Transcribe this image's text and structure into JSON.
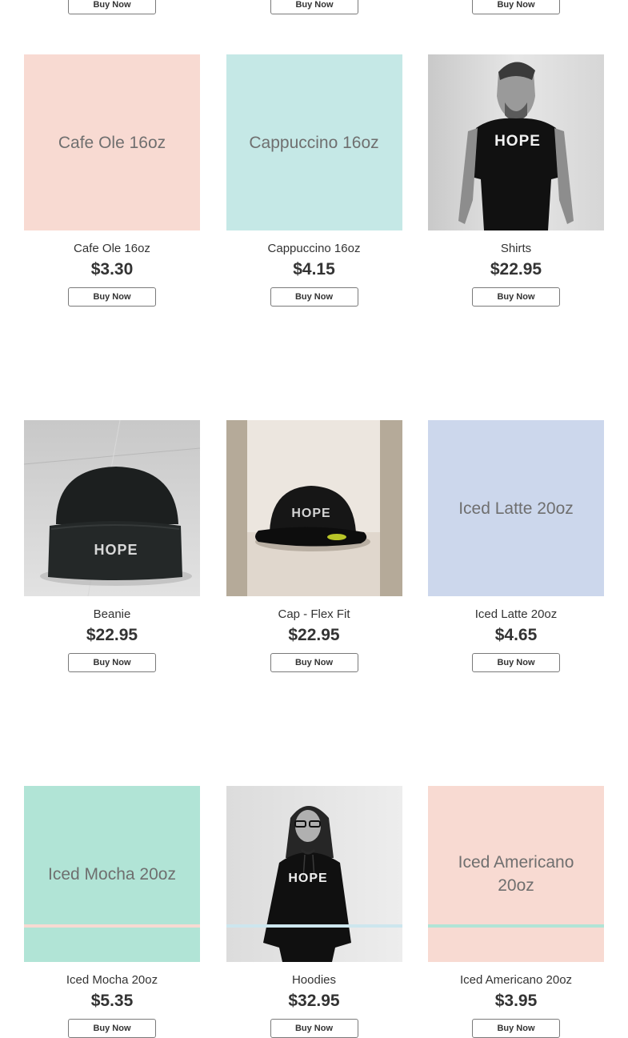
{
  "colors": {
    "pink": "#f8dad2",
    "teal": "#c5e8e6",
    "lavender": "#ccd7ec",
    "mint": "#b1e4d6",
    "peek_blue": "#cde6ee"
  },
  "top_row": {
    "buttons": [
      "Buy Now",
      "Buy Now",
      "Buy Now"
    ]
  },
  "products": [
    {
      "name": "Cafe Ole 16oz",
      "price": "$3.30",
      "tile_text": "Cafe Ole 16oz",
      "tile": "pink",
      "button": "Buy Now"
    },
    {
      "name": "Cappuccino 16oz",
      "price": "$4.15",
      "tile_text": "Cappuccino 16oz",
      "tile": "teal",
      "button": "Buy Now"
    },
    {
      "name": "Shirts",
      "price": "$22.95",
      "photo": "man-in-black-hope-tshirt",
      "photo_text": "HOPE",
      "button": "Buy Now"
    },
    {
      "name": "Beanie",
      "price": "$22.95",
      "photo": "black-hope-beanie",
      "photo_text": "HOPE",
      "button": "Buy Now"
    },
    {
      "name": "Cap - Flex Fit",
      "price": "$22.95",
      "photo": "black-hope-flexfit-cap",
      "photo_text": "HOPE",
      "button": "Buy Now"
    },
    {
      "name": "Iced Latte 20oz",
      "price": "$4.65",
      "tile_text": "Iced Latte 20oz",
      "tile": "lavender",
      "button": "Buy Now"
    },
    {
      "name": "Iced Mocha 20oz",
      "price": "$5.35",
      "tile_text": "Iced Mocha 20oz",
      "tile": "mint",
      "button": "Buy Now"
    },
    {
      "name": "Hoodies",
      "price": "$32.95",
      "photo": "woman-in-black-hope-hoodie",
      "photo_text": "HOPE",
      "button": "Buy Now"
    },
    {
      "name": "Iced Americano 20oz",
      "price": "$3.95",
      "tile_text": "Iced Americano 20oz",
      "tile": "pink",
      "button": "Buy Now"
    }
  ]
}
